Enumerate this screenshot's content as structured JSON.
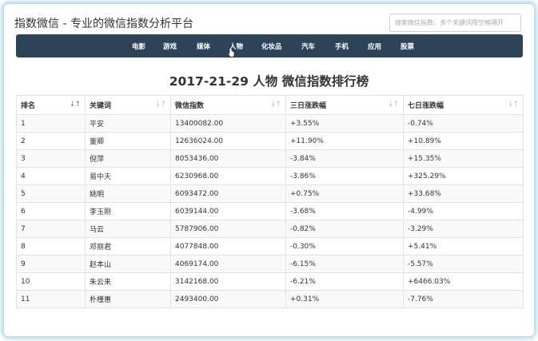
{
  "header": {
    "site_title": "指数微信 - 专业的微信指数分析平台",
    "search_placeholder": "搜索微信指数，多个关键词用空格隔开"
  },
  "nav": {
    "items": [
      {
        "label": "电影"
      },
      {
        "label": "游戏"
      },
      {
        "label": "媒体"
      },
      {
        "label": "人物"
      },
      {
        "label": "化妆品"
      },
      {
        "label": "汽车"
      },
      {
        "label": "手机"
      },
      {
        "label": "应用"
      },
      {
        "label": "股票"
      }
    ]
  },
  "page": {
    "title": "2017-21-29 人物 微信指数排行榜"
  },
  "table": {
    "columns": [
      "排名",
      "关键词",
      "微信指数",
      "三日涨跌幅",
      "七日涨跌幅"
    ],
    "rows": [
      [
        "1",
        "平安",
        "13400082.00",
        "+3.55%",
        "-0.74%"
      ],
      [
        "2",
        "董卿",
        "12636024.00",
        "+11.90%",
        "+10.89%"
      ],
      [
        "3",
        "倪萍",
        "8053436.00",
        "-3.84%",
        "+15.35%"
      ],
      [
        "4",
        "易中天",
        "6230968.00",
        "-3.86%",
        "+325.29%"
      ],
      [
        "5",
        "姚明",
        "6093472.00",
        "+0.75%",
        "+33.68%"
      ],
      [
        "6",
        "李玉刚",
        "6039144.00",
        "-3.68%",
        "-4.99%"
      ],
      [
        "7",
        "马云",
        "5787906.00",
        "-0.82%",
        "-3.29%"
      ],
      [
        "8",
        "邓丽君",
        "4077848.00",
        "-0.30%",
        "+5.41%"
      ],
      [
        "9",
        "赵本山",
        "4069174.00",
        "-6.15%",
        "-5.57%"
      ],
      [
        "10",
        "朱云来",
        "3142168.00",
        "-6.21%",
        "+6466.03%"
      ],
      [
        "11",
        "朴槿惠",
        "2493400.00",
        "+0.31%",
        "-7.76%"
      ]
    ]
  },
  "icons": {
    "sort": "sort-icon",
    "cursor": "hand-cursor-icon"
  },
  "colors": {
    "navbar": "#2d4458",
    "frame_glow": "#96c3e1"
  }
}
